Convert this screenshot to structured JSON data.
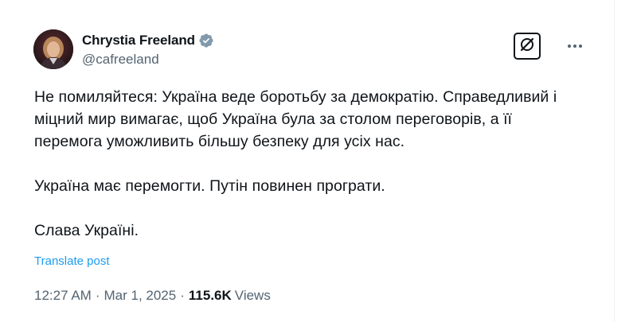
{
  "author": {
    "display_name": "Chrystia Freeland",
    "handle": "@cafreeland",
    "verified_color": "#829aab"
  },
  "icons": {
    "grok": "grok-icon",
    "more": "more-options-icon",
    "verified": "verified-badge-icon"
  },
  "post": {
    "paragraph_1": "Не помиляйтеся: Україна веде боротьбу за демократію. Справедливий і\nміцний мир вимагає, щоб Україна була за столом переговорів, а її\nперемога уможливить більшу безпеку для усіх нас.",
    "paragraph_2": "Україна має перемогти. Путін повинен програти.",
    "paragraph_3": "Слава Україні.",
    "translate_label": "Translate post"
  },
  "meta": {
    "time": "12:27 AM",
    "separator": "·",
    "date": "Mar 1, 2025",
    "views_count": "115.6K",
    "views_label": "Views"
  },
  "colors": {
    "text": "#0f1419",
    "secondary": "#536471",
    "link": "#1d9bf0"
  }
}
